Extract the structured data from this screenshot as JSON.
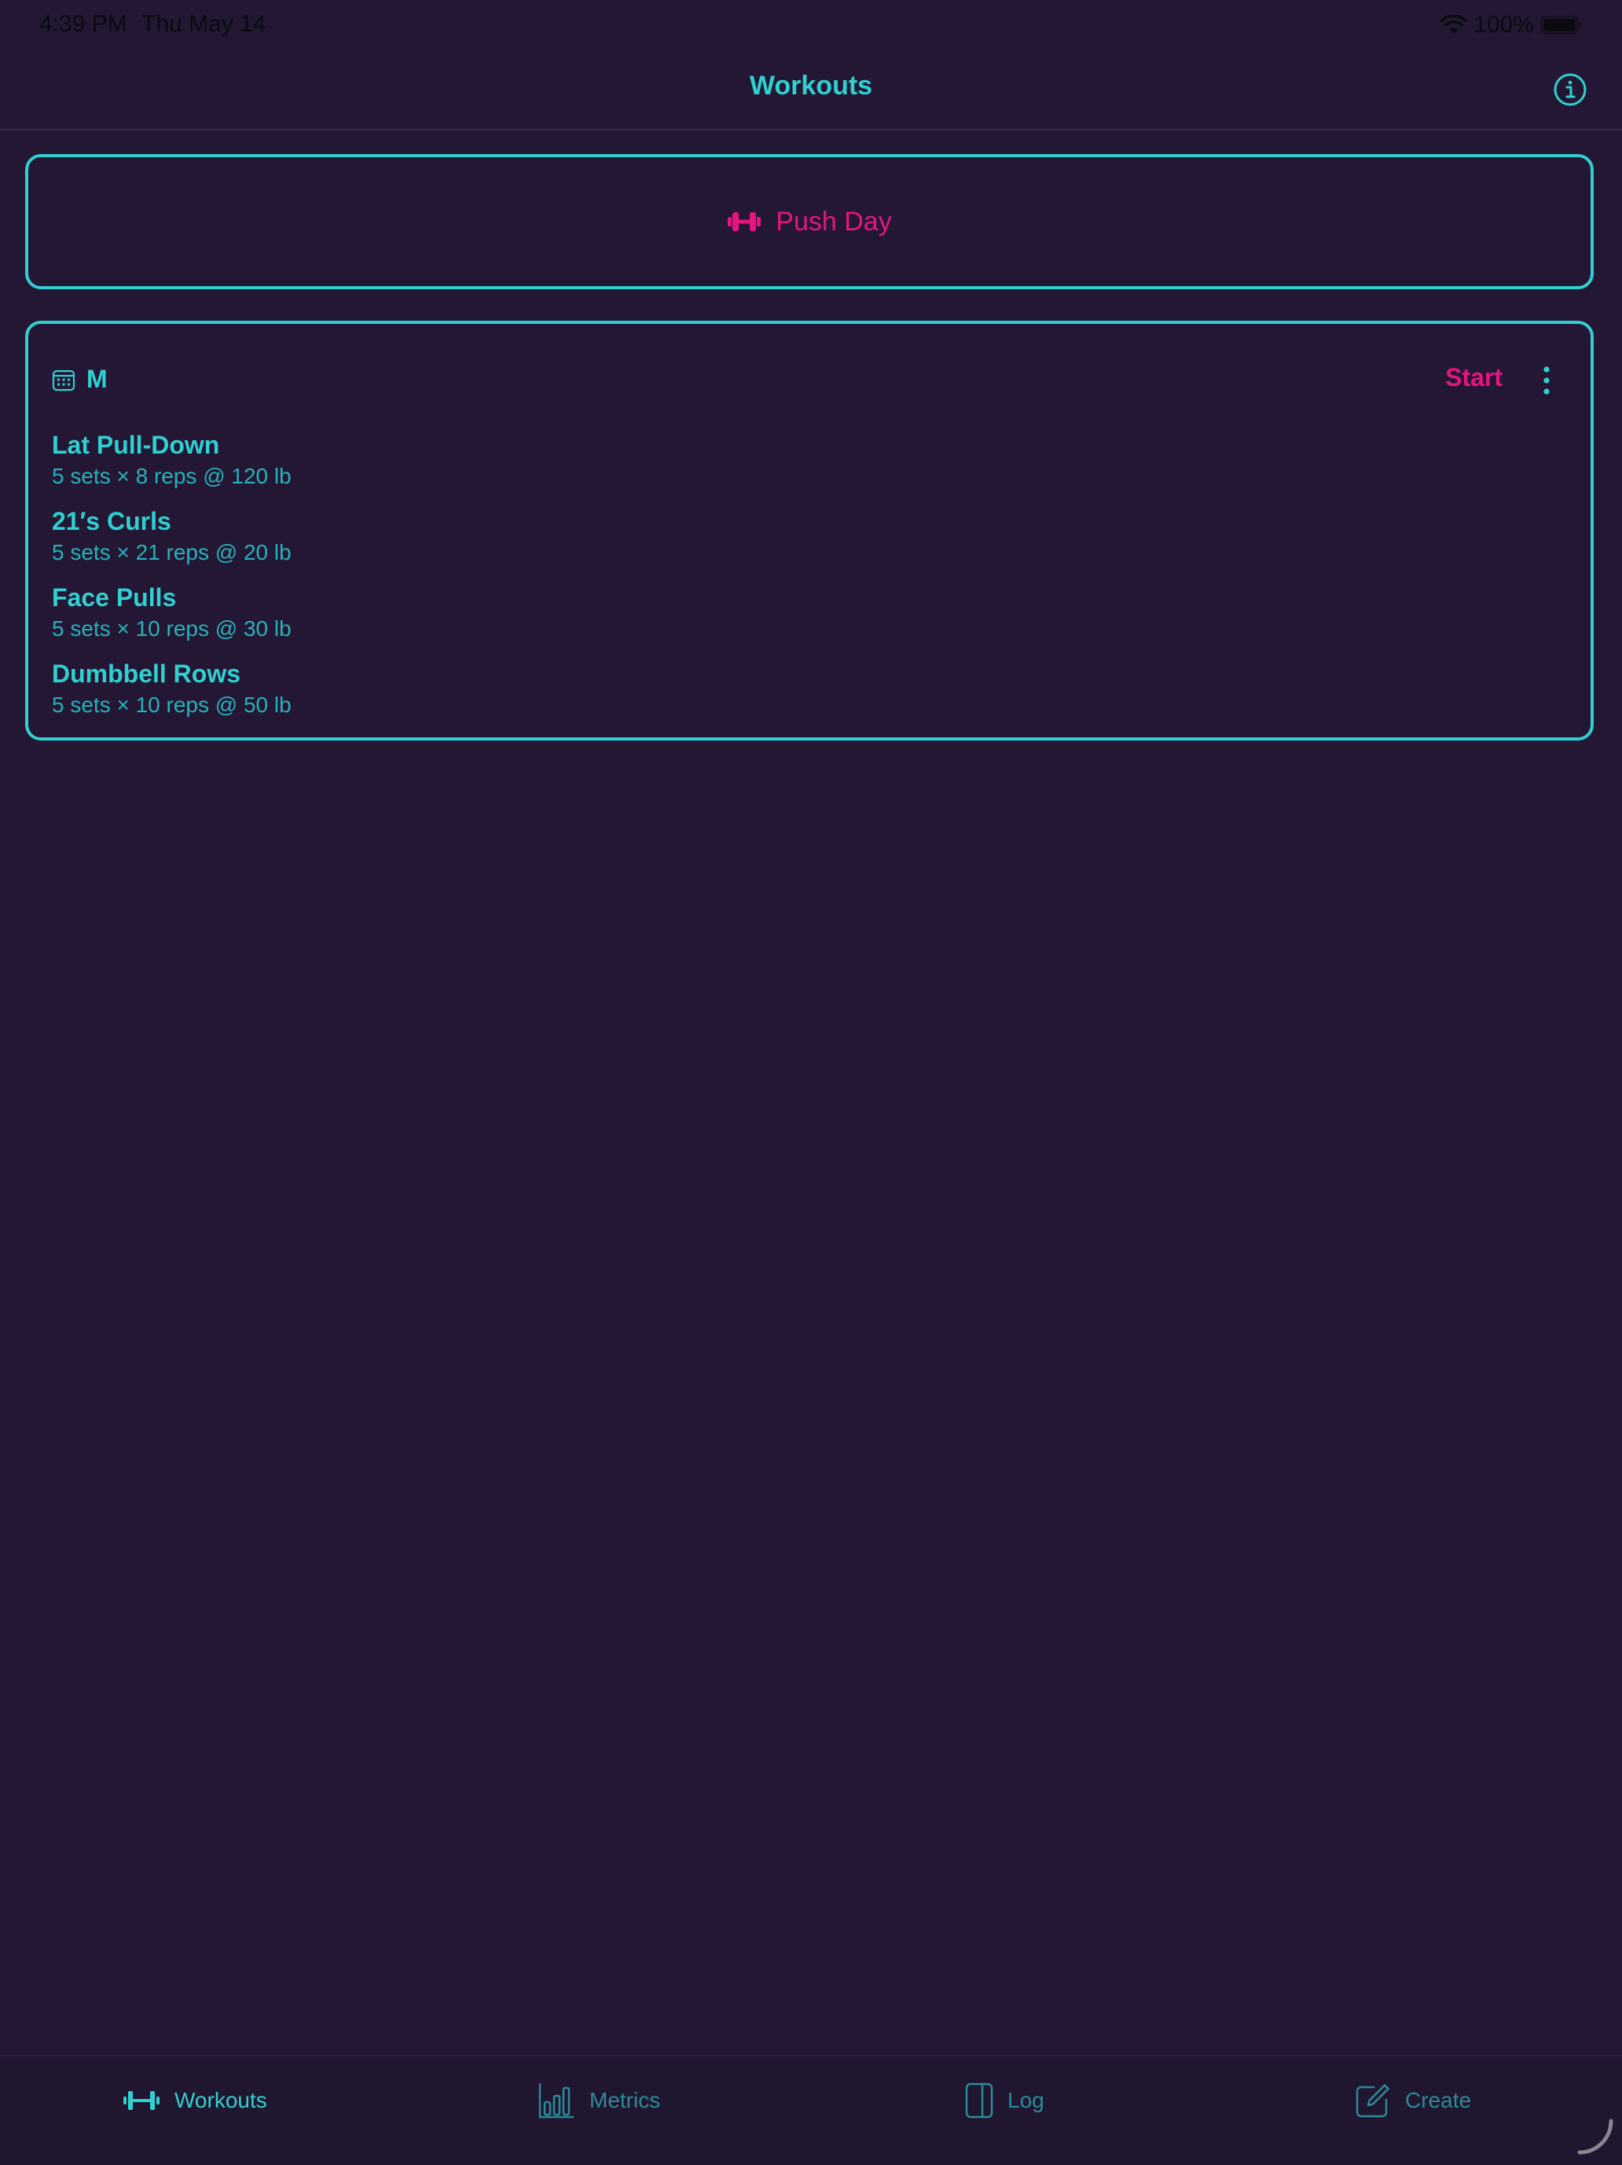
{
  "status_bar": {
    "time": "4:39 PM",
    "date": "Thu May 14",
    "battery": "100%"
  },
  "nav": {
    "title": "Workouts"
  },
  "workout": {
    "title": "Push Day"
  },
  "day_card": {
    "day": "M",
    "start_label": "Start",
    "exercises": [
      {
        "name": "Lat Pull-Down",
        "detail": "5 sets × 8 reps @ 120 lb"
      },
      {
        "name": "21′s Curls",
        "detail": "5 sets × 21 reps @ 20 lb"
      },
      {
        "name": "Face Pulls",
        "detail": "5 sets × 10 reps @ 30 lb"
      },
      {
        "name": "Dumbbell Rows",
        "detail": "5 sets × 10 reps @ 50 lb"
      }
    ]
  },
  "tabs": [
    {
      "label": "Workouts",
      "icon": "dumbbell-icon",
      "selected": true
    },
    {
      "label": "Metrics",
      "icon": "bar-chart-icon",
      "selected": false
    },
    {
      "label": "Log",
      "icon": "book-icon",
      "selected": false
    },
    {
      "label": "Create",
      "icon": "compose-icon",
      "selected": false
    }
  ],
  "colors": {
    "background": "#231733",
    "accent": "#2fd0d2",
    "highlight": "#e6157d",
    "inactive_tab": "#2a8b98"
  }
}
